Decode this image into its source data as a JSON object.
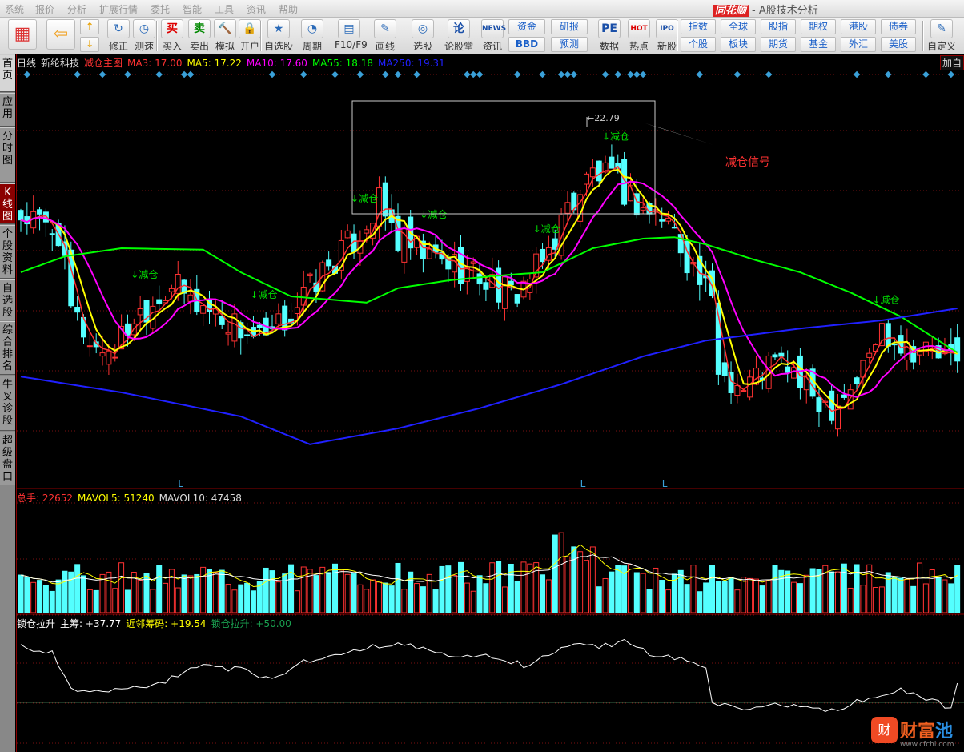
{
  "menu": [
    "系统",
    "报价",
    "分析",
    "扩展行情",
    "委托",
    "智能",
    "工具",
    "资讯",
    "帮助"
  ],
  "title": {
    "logo": "同花顺",
    "text": "- A股技术分析"
  },
  "toolbar": {
    "big": [
      {
        "label": "",
        "icon": "grid-icon"
      },
      {
        "label": "",
        "icon": "back-arrow-icon"
      },
      {
        "label": "修正",
        "icon": "refresh-icon"
      },
      {
        "label": "测速",
        "icon": "clock-icon"
      },
      {
        "label": "买入",
        "icon": "buy-icon",
        "glyph": "买"
      },
      {
        "label": "卖出",
        "icon": "sell-icon",
        "glyph": "卖"
      },
      {
        "label": "模拟",
        "icon": "gavel-icon"
      },
      {
        "label": "开户",
        "icon": "lock-icon"
      },
      {
        "label": "自选股",
        "icon": "star-folder-icon"
      },
      {
        "label": "周期",
        "icon": "period-clock-icon"
      },
      {
        "label": "F10/F9",
        "icon": "f10-icon"
      },
      {
        "label": "画线",
        "icon": "pencil-icon"
      },
      {
        "label": "选股",
        "icon": "radar-icon"
      },
      {
        "label": "论股堂",
        "icon": "lun-icon",
        "glyph": "论"
      },
      {
        "label": "资讯",
        "icon": "news-icon",
        "glyph": "NEWS"
      },
      {
        "label": "数据",
        "icon": "pe-icon",
        "glyph": "PE"
      },
      {
        "label": "热点",
        "icon": "hot-icon",
        "glyph": "HOT"
      },
      {
        "label": "新股",
        "icon": "ipo-icon",
        "glyph": "IPO"
      },
      {
        "label": "自定义",
        "icon": "customize-icon"
      }
    ],
    "small": [
      "资金",
      "BBD",
      "研报",
      "预测",
      "指数",
      "个股",
      "全球",
      "板块",
      "股指",
      "期货",
      "期权",
      "基金",
      "港股",
      "外汇",
      "债券",
      "美股"
    ]
  },
  "sidebar": [
    "首页",
    "应用",
    "分时图",
    "K线图",
    "个股资料",
    "自选股",
    "综合排名",
    "牛叉诊股",
    "超级盘口"
  ],
  "main_header": {
    "period": "日线",
    "stock": "新纶科技",
    "indicator": "减仓主图",
    "ma3": "MA3: 17.00",
    "ma5": "MA5: 17.22",
    "ma10": "MA10: 17.60",
    "ma55": "MA55: 18.18",
    "ma250": "MA250: 19.31",
    "add": "加自"
  },
  "colors": {
    "up": "#ff3232",
    "down": "#54ffff",
    "ma3": "#ff3232",
    "ma5": "#ffff00",
    "ma10": "#ff00ff",
    "ma55": "#00ff00",
    "ma250": "#2020ff"
  },
  "annotations": {
    "signal_label": "减仓",
    "high_value": "22.79",
    "callout": "减仓信号",
    "low_mark": "L"
  },
  "signal_bars": [
    1,
    9,
    13,
    17,
    22,
    26,
    27,
    27,
    40,
    45,
    50,
    54,
    58,
    60,
    63,
    71,
    72,
    73,
    79,
    83,
    86,
    87,
    88,
    93,
    95,
    97,
    98,
    99,
    108,
    114,
    119,
    133,
    138,
    144,
    148
  ],
  "reduce_labels": [
    18,
    37,
    53,
    64,
    82,
    93,
    136
  ],
  "low_bars": [
    25,
    89,
    102
  ],
  "price_keypoints": [
    [
      0,
      21.23
    ],
    [
      6,
      20.89
    ],
    [
      8,
      19.23
    ],
    [
      12,
      18.48
    ],
    [
      15,
      18.48
    ],
    [
      18,
      19.14
    ],
    [
      24,
      19.81
    ],
    [
      27,
      19.48
    ],
    [
      31,
      19.23
    ],
    [
      35,
      18.89
    ],
    [
      39,
      18.56
    ],
    [
      43,
      19.23
    ],
    [
      48,
      20.06
    ],
    [
      53,
      20.73
    ],
    [
      57,
      21.48
    ],
    [
      60,
      20.73
    ],
    [
      64,
      20.39
    ],
    [
      69,
      20.23
    ],
    [
      73,
      19.98
    ],
    [
      78,
      19.56
    ],
    [
      83,
      20.23
    ],
    [
      87,
      21.39
    ],
    [
      91,
      22.14
    ],
    [
      95,
      21.89
    ],
    [
      99,
      21.39
    ],
    [
      103,
      21.14
    ],
    [
      106,
      20.39
    ],
    [
      110,
      19.39
    ],
    [
      111,
      18.06
    ],
    [
      115,
      17.64
    ],
    [
      119,
      18.14
    ],
    [
      122,
      18.14
    ],
    [
      125,
      17.56
    ],
    [
      129,
      17.31
    ],
    [
      133,
      17.81
    ],
    [
      137,
      18.89
    ],
    [
      141,
      18.56
    ],
    [
      145,
      18.39
    ],
    [
      149,
      18.14
    ]
  ],
  "ma55_keypoints": [
    [
      0,
      20.06
    ],
    [
      7,
      20.39
    ],
    [
      16,
      20.56
    ],
    [
      29,
      20.53
    ],
    [
      35,
      20.06
    ],
    [
      43,
      19.56
    ],
    [
      55,
      19.43
    ],
    [
      60,
      19.73
    ],
    [
      68,
      19.89
    ],
    [
      75,
      19.98
    ],
    [
      83,
      20.06
    ],
    [
      91,
      20.56
    ],
    [
      99,
      20.76
    ],
    [
      104,
      20.79
    ],
    [
      109,
      20.64
    ],
    [
      117,
      20.31
    ],
    [
      124,
      20.06
    ],
    [
      132,
      19.64
    ],
    [
      140,
      19.14
    ],
    [
      149,
      18.39
    ]
  ],
  "ma250_keypoints": [
    [
      0,
      17.89
    ],
    [
      16,
      17.56
    ],
    [
      35,
      17.06
    ],
    [
      46,
      16.48
    ],
    [
      60,
      16.81
    ],
    [
      73,
      17.23
    ],
    [
      86,
      17.73
    ],
    [
      99,
      18.31
    ],
    [
      109,
      18.64
    ],
    [
      124,
      18.89
    ],
    [
      137,
      19.06
    ],
    [
      149,
      19.31
    ]
  ],
  "volume": {
    "total": "总手: 22652",
    "mavol5": "MAVOL5: 51240",
    "mavol10": "MAVOL10: 47458"
  },
  "indicator": {
    "name": "锁仓拉升",
    "main": "主筹: +37.77",
    "near": "近邻筹码: +19.54",
    "lock": "锁仓拉升: +50.00",
    "keypoints": [
      [
        0,
        88
      ],
      [
        5,
        82
      ],
      [
        8,
        50
      ],
      [
        12,
        48
      ],
      [
        18,
        53
      ],
      [
        22,
        55
      ],
      [
        28,
        72
      ],
      [
        35,
        68
      ],
      [
        40,
        60
      ],
      [
        45,
        75
      ],
      [
        50,
        80
      ],
      [
        55,
        88
      ],
      [
        60,
        90
      ],
      [
        65,
        85
      ],
      [
        70,
        78
      ],
      [
        75,
        80
      ],
      [
        80,
        72
      ],
      [
        85,
        82
      ],
      [
        88,
        92
      ],
      [
        92,
        88
      ],
      [
        96,
        92
      ],
      [
        100,
        82
      ],
      [
        105,
        78
      ],
      [
        109,
        70
      ],
      [
        110,
        40
      ],
      [
        115,
        32
      ],
      [
        120,
        38
      ],
      [
        125,
        35
      ],
      [
        130,
        34
      ],
      [
        135,
        45
      ],
      [
        140,
        50
      ],
      [
        145,
        42
      ],
      [
        148,
        35
      ],
      [
        149,
        55
      ]
    ]
  },
  "watermark": {
    "glyph": "财",
    "name1": "财富",
    "name2": "池",
    "url": "www.cfchi.com"
  }
}
